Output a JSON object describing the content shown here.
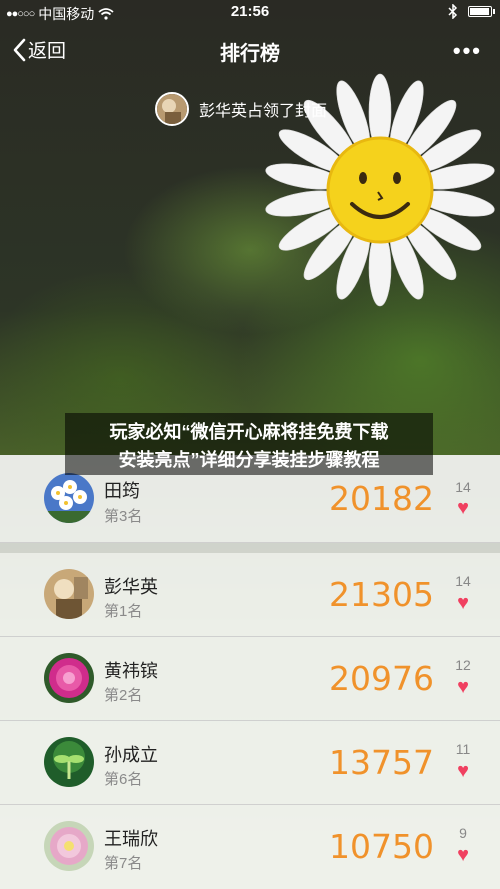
{
  "status_bar": {
    "signal": "●●○○○",
    "carrier": "中国移动",
    "time": "21:56"
  },
  "nav": {
    "back_label": "返回",
    "title": "排行榜",
    "more_label": "•••"
  },
  "cover": {
    "caption": "彭华英占领了封面"
  },
  "overlay_title": {
    "line1": "玩家必知“微信开心麻将挂免费下载",
    "line2": "安装亮点”详细分享装挂步骤教程"
  },
  "ranking": [
    {
      "name": "田筠",
      "rank": "第3名",
      "score": "20182",
      "likes": "14",
      "avatar": "daisy-bouquet"
    },
    {
      "name": "彭华英",
      "rank": "第1名",
      "score": "21305",
      "likes": "14",
      "avatar": "sepia-photo"
    },
    {
      "name": "黄祎镔",
      "rank": "第2名",
      "score": "20976",
      "likes": "12",
      "avatar": "pink-flower"
    },
    {
      "name": "孙成立",
      "rank": "第6名",
      "score": "13757",
      "likes": "11",
      "avatar": "sprout"
    },
    {
      "name": "王瑞欣",
      "rank": "第7名",
      "score": "10750",
      "likes": "9",
      "avatar": "pink-flower-light"
    }
  ],
  "colors": {
    "score": "#f0922b",
    "heart": "#f04060"
  }
}
